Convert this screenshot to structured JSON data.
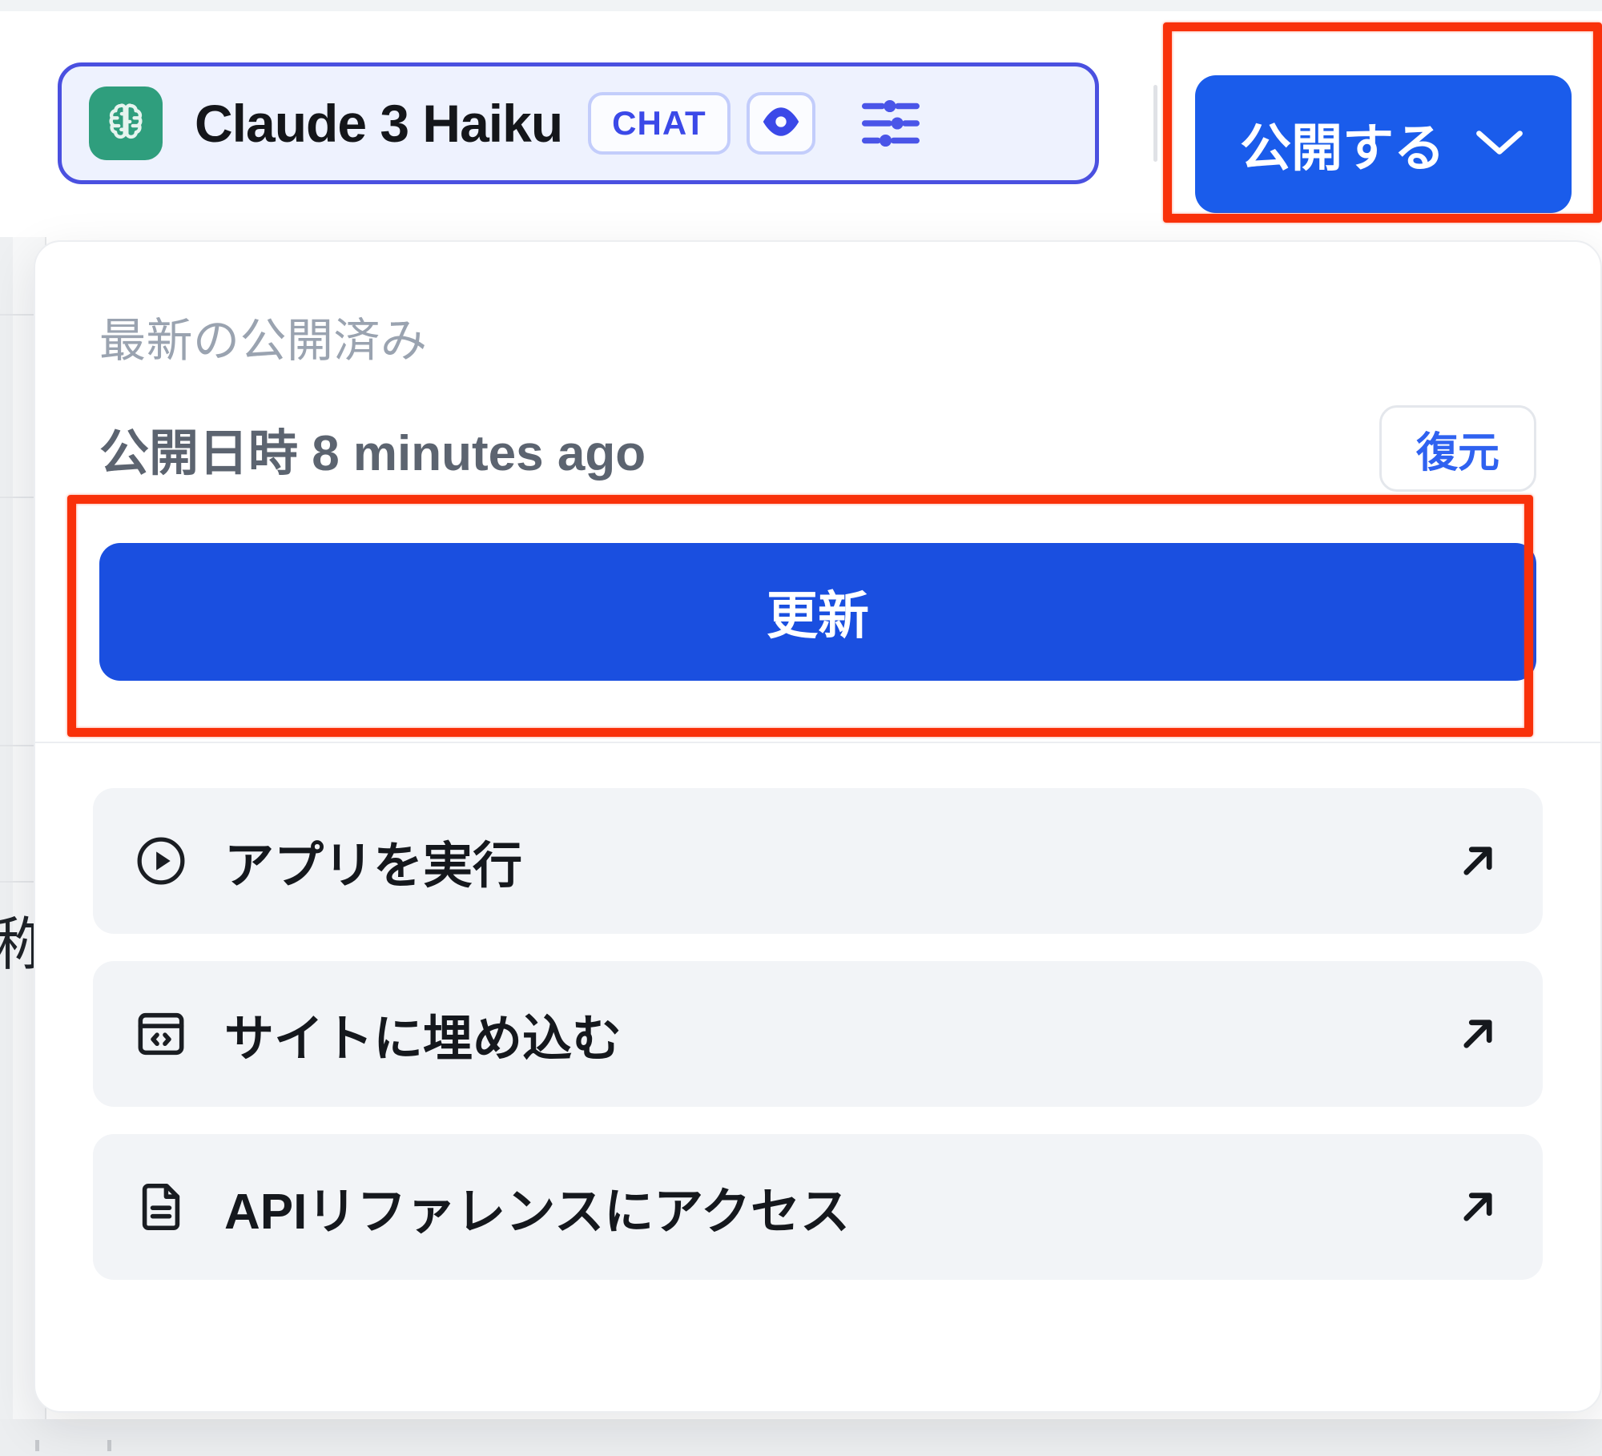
{
  "header": {
    "model": {
      "icon": "brain-circuit-icon",
      "name": "Claude 3 Haiku",
      "badges": [
        {
          "icon": "",
          "label": "CHAT",
          "name": "chat-badge"
        },
        {
          "icon": "eye-icon",
          "label": "",
          "name": "vision-badge"
        }
      ],
      "settings_icon": "sliders-icon"
    },
    "publish": {
      "label": "公開する",
      "chevron_icon": "chevron-down-icon",
      "color": "#1a5ceb"
    }
  },
  "popover": {
    "kicker": "最新の公開済み",
    "published_at_label": "公開日時 8 minutes ago",
    "restore_label": "復元",
    "update_label": "更新",
    "update_color": "#1a4fe0",
    "restore_text_color": "#2f62f0",
    "menu_items": [
      {
        "icon": "play-circle-icon",
        "label": "アプリを実行",
        "trailing_icon": "arrow-up-right-icon"
      },
      {
        "icon": "embed-code-icon",
        "label": "サイトに埋め込む",
        "trailing_icon": "arrow-up-right-icon"
      },
      {
        "icon": "document-icon",
        "label": "APIリファレンスにアクセス",
        "trailing_icon": "arrow-up-right-icon"
      }
    ]
  },
  "background": {
    "ghost_glyph": "称"
  },
  "annotations": {
    "color": "#f9310a",
    "boxes": [
      {
        "name": "publish-button-highlight",
        "target": "publish-button"
      },
      {
        "name": "update-button-highlight",
        "target": "update-button"
      }
    ]
  }
}
